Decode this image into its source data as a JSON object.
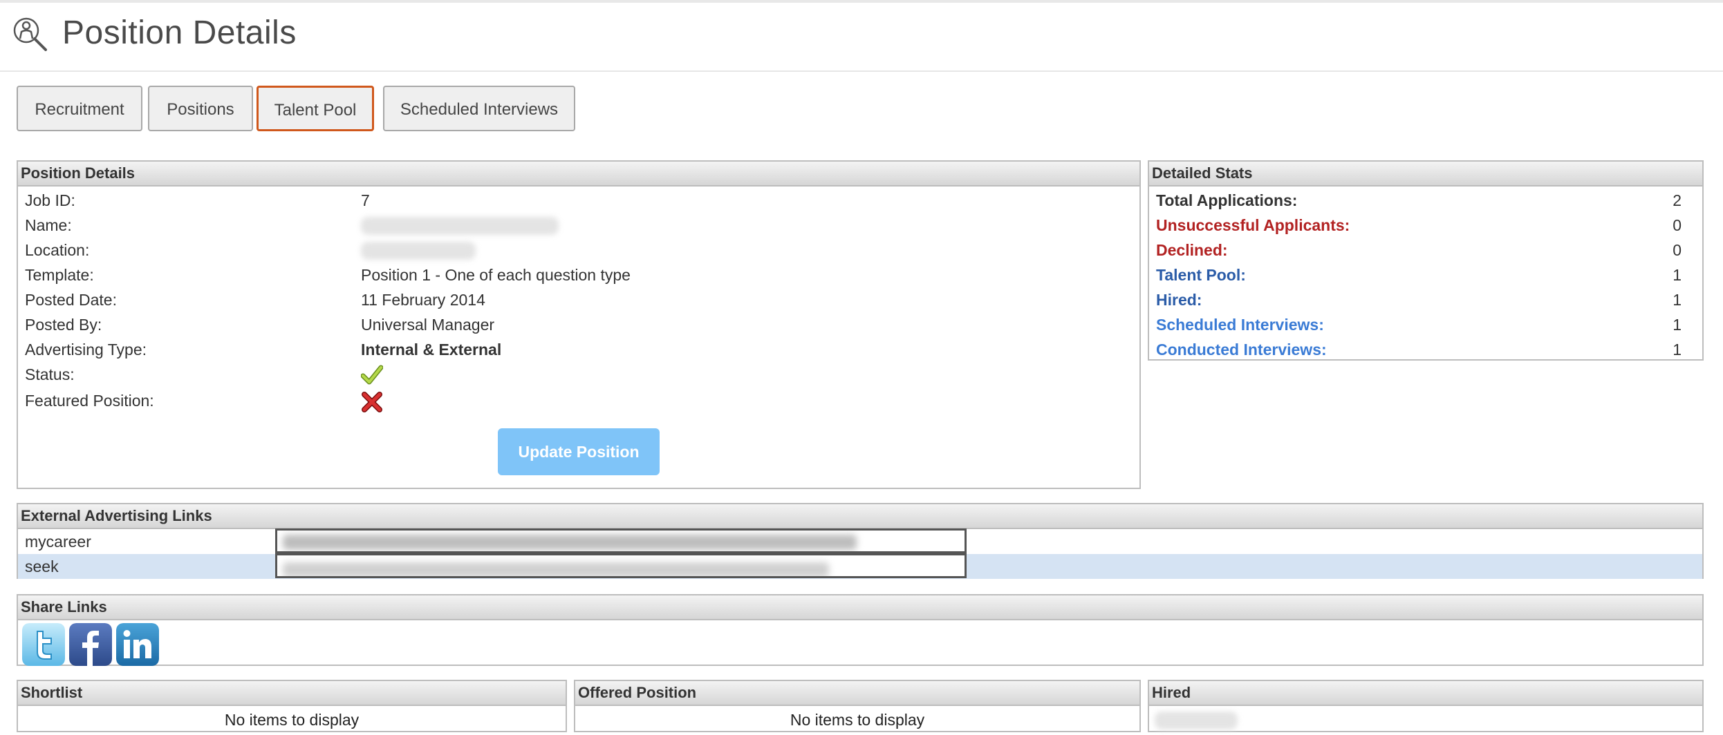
{
  "page": {
    "title": "Position Details",
    "icon": "person-search-icon"
  },
  "tabs": [
    {
      "label": "Recruitment",
      "active": false
    },
    {
      "label": "Positions",
      "active": false
    },
    {
      "label": "Talent Pool",
      "active": true
    },
    {
      "label": "Scheduled Interviews",
      "active": false
    }
  ],
  "position_details": {
    "heading": "Position Details",
    "fields": [
      {
        "label": "Job ID:",
        "value": "7"
      },
      {
        "label": "Name:",
        "value": ""
      },
      {
        "label": "Location:",
        "value": ""
      },
      {
        "label": "Template:",
        "value": "Position 1 - One of each question type"
      },
      {
        "label": "Posted Date:",
        "value": "11 February 2014"
      },
      {
        "label": "Posted By:",
        "value": "Universal Manager"
      },
      {
        "label": "Advertising Type:",
        "value": "Internal & External"
      },
      {
        "label": "Status:",
        "icon": "check-icon"
      },
      {
        "label": "Featured Position:",
        "icon": "cross-icon"
      }
    ],
    "update_button": "Update Position"
  },
  "detailed_stats": {
    "heading": "Detailed Stats",
    "items": [
      {
        "label": "Total Applications:",
        "value": "2",
        "color": "#333333"
      },
      {
        "label": "Unsuccessful Applicants:",
        "value": "0",
        "color": "#b22222"
      },
      {
        "label": "Declined:",
        "value": "0",
        "color": "#b22222"
      },
      {
        "label": "Talent Pool:",
        "value": "1",
        "color": "#2b5ca8"
      },
      {
        "label": "Hired:",
        "value": "1",
        "color": "#2b5ca8"
      },
      {
        "label": "Scheduled Interviews:",
        "value": "1",
        "color": "#3a7bd5"
      },
      {
        "label": "Conducted Interviews:",
        "value": "1",
        "color": "#3a7bd5"
      }
    ]
  },
  "external_links": {
    "heading": "External Advertising Links",
    "rows": [
      {
        "label": "mycareer",
        "highlight": false
      },
      {
        "label": "seek",
        "highlight": true
      }
    ],
    "highlight_color": "#d5e3f3"
  },
  "share_links": {
    "heading": "Share Links",
    "items": [
      "twitter-icon",
      "facebook-icon",
      "linkedin-icon"
    ]
  },
  "shortlist": {
    "heading": "Shortlist",
    "empty": "No items to display"
  },
  "offered": {
    "heading": "Offered Position",
    "empty": "No items to display"
  },
  "hired": {
    "heading": "Hired"
  }
}
